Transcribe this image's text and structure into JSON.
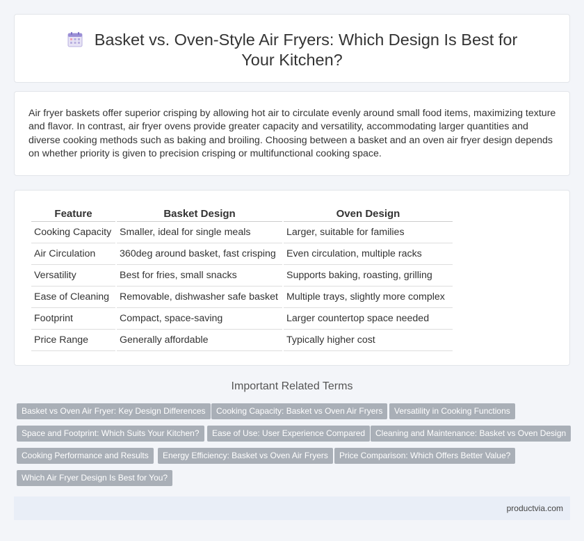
{
  "header": {
    "icon": "calendar-icon",
    "title": "Basket vs. Oven-Style Air Fryers: Which Design Is Best for Your Kitchen?"
  },
  "intro": {
    "text": "Air fryer baskets offer superior crisping by allowing hot air to circulate evenly around small food items, maximizing texture and flavor. In contrast, air fryer ovens provide greater capacity and versatility, accommodating larger quantities and diverse cooking methods such as baking and broiling. Choosing between a basket and an oven air fryer design depends on whether priority is given to precision crisping or multifunctional cooking space."
  },
  "table": {
    "headers": [
      "Feature",
      "Basket Design",
      "Oven Design"
    ],
    "rows": [
      [
        "Cooking Capacity",
        "Smaller, ideal for single meals",
        "Larger, suitable for families"
      ],
      [
        "Air Circulation",
        "360deg around basket, fast crisping",
        "Even circulation, multiple racks"
      ],
      [
        "Versatility",
        "Best for fries, small snacks",
        "Supports baking, roasting, grilling"
      ],
      [
        "Ease of Cleaning",
        "Removable, dishwasher safe basket",
        "Multiple trays, slightly more complex"
      ],
      [
        "Footprint",
        "Compact, space-saving",
        "Larger countertop space needed"
      ],
      [
        "Price Range",
        "Generally affordable",
        "Typically higher cost"
      ]
    ]
  },
  "related": {
    "heading": "Important Related Terms",
    "tags": [
      "Basket vs Oven Air Fryer: Key Design Differences",
      "Cooking Capacity: Basket vs Oven Air Fryers",
      "Versatility in Cooking Functions",
      "Space and Footprint: Which Suits Your Kitchen?",
      "Ease of Use: User Experience Compared",
      "Cleaning and Maintenance: Basket vs Oven Design",
      "Cooking Performance and Results",
      "Energy Efficiency: Basket vs Oven Air Fryers",
      "Price Comparison: Which Offers Better Value?",
      "Which Air Fryer Design Is Best for You?"
    ]
  },
  "footer": {
    "site": "productvia.com"
  },
  "colors": {
    "tag_bg": "#a9afb7",
    "footer_bg": "#e9eef7",
    "page_bg": "#f3f5f9"
  }
}
